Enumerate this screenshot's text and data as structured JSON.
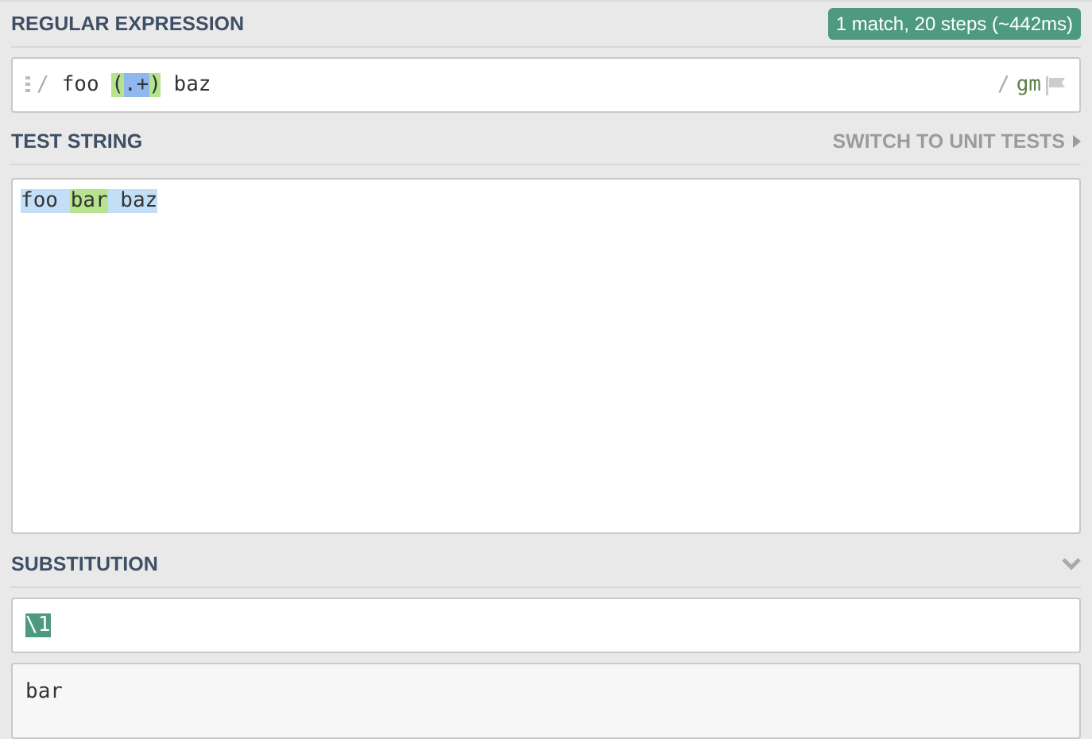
{
  "regex": {
    "heading": "REGULAR EXPRESSION",
    "status": "1 match, 20 steps (~442ms)",
    "delimiter_open": "/",
    "tokens": [
      {
        "text": "foo ",
        "kind": "plain"
      },
      {
        "text": "(",
        "kind": "group"
      },
      {
        "text": ".+",
        "kind": "token"
      },
      {
        "text": ")",
        "kind": "group"
      },
      {
        "text": " baz",
        "kind": "plain"
      }
    ],
    "delimiter_close": "/",
    "flags": "gm"
  },
  "test_string": {
    "heading": "TEST STRING",
    "switch_link": "SWITCH TO UNIT TESTS",
    "segments": [
      {
        "text": "foo ",
        "kind": "match"
      },
      {
        "text": "bar",
        "kind": "group"
      },
      {
        "text": " baz",
        "kind": "match"
      }
    ]
  },
  "substitution": {
    "heading": "SUBSTITUTION",
    "expanded": true,
    "value": "\\1",
    "result": "bar"
  }
}
